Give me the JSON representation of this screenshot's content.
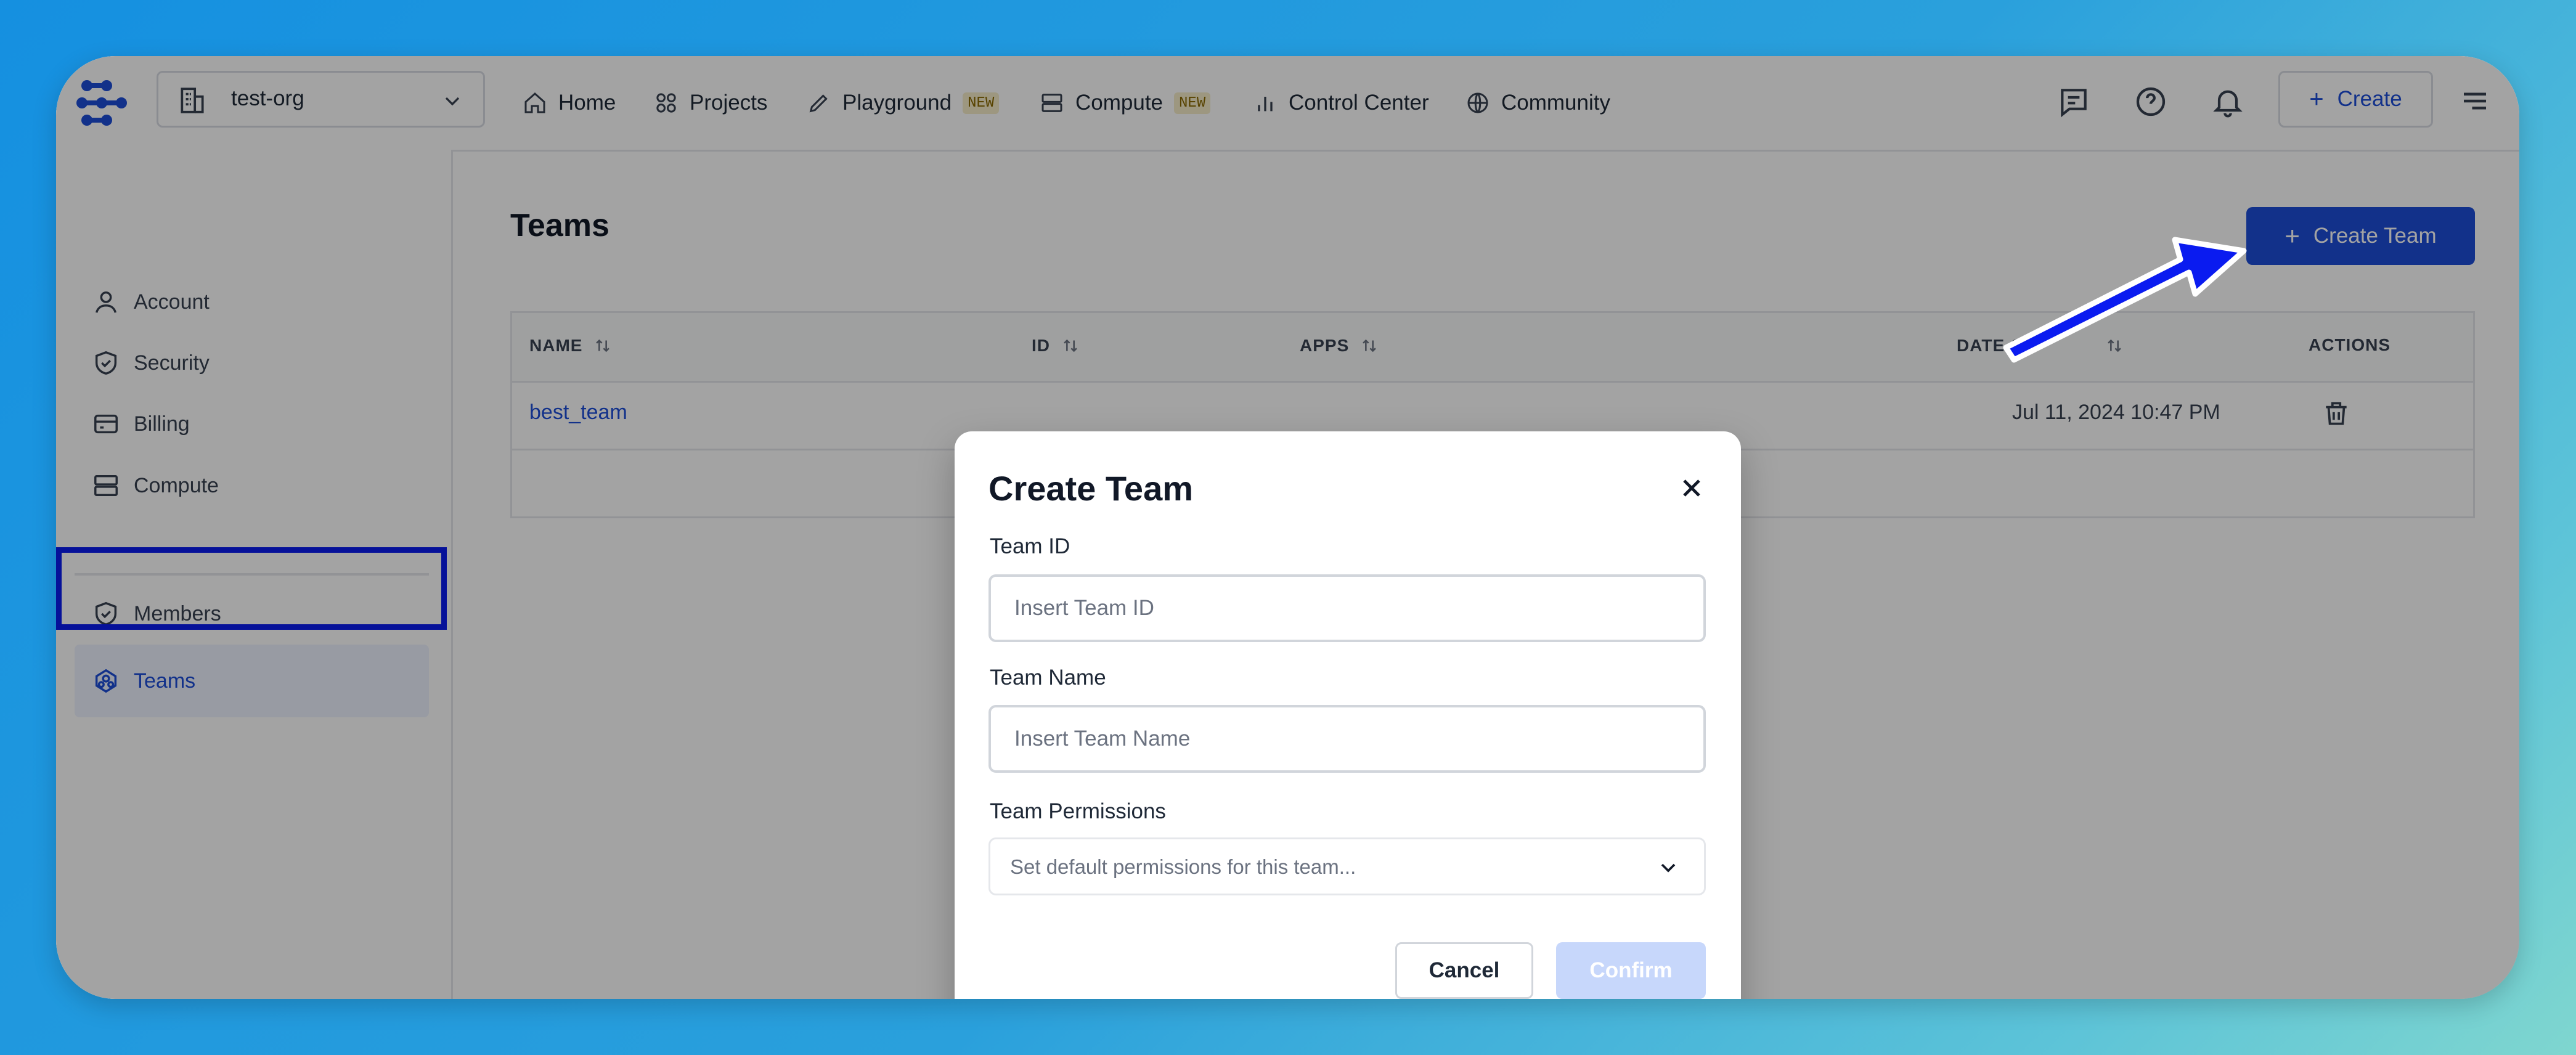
{
  "topbar": {
    "org_name": "test-org",
    "nav": [
      {
        "label": "Home",
        "icon": "home-icon"
      },
      {
        "label": "Projects",
        "icon": "grid-icon"
      },
      {
        "label": "Playground",
        "icon": "pencil-icon",
        "badge": "NEW"
      },
      {
        "label": "Compute",
        "icon": "server-icon",
        "badge": "NEW"
      },
      {
        "label": "Control Center",
        "icon": "bar-chart-icon"
      },
      {
        "label": "Community",
        "icon": "globe-icon"
      }
    ],
    "create_label": "Create"
  },
  "sidebar": {
    "items": [
      {
        "label": "Account",
        "icon": "user-icon"
      },
      {
        "label": "Security",
        "icon": "shield-icon"
      },
      {
        "label": "Billing",
        "icon": "credit-card-icon"
      },
      {
        "label": "Compute",
        "icon": "server-icon"
      },
      {
        "label": "Members",
        "icon": "shield-icon"
      },
      {
        "label": "Teams",
        "icon": "teams-icon",
        "active": true
      }
    ]
  },
  "main": {
    "title": "Teams",
    "create_team_label": "Create Team",
    "table": {
      "columns": [
        "NAME",
        "ID",
        "APPS",
        "DATE CR",
        "ACTIONS"
      ],
      "rows": [
        {
          "name": "best_team",
          "date": "Jul 11, 2024 10:47 PM"
        }
      ]
    }
  },
  "modal": {
    "title": "Create Team",
    "team_id_label": "Team ID",
    "team_id_placeholder": "Insert Team ID",
    "team_name_label": "Team Name",
    "team_name_placeholder": "Insert Team Name",
    "permissions_label": "Team Permissions",
    "permissions_placeholder": "Set default permissions for this team...",
    "cancel_label": "Cancel",
    "confirm_label": "Confirm"
  },
  "colors": {
    "accent": "#1d4ed8",
    "annotation": "#0a1bf0",
    "badge_bg": "#f6ecc8"
  }
}
